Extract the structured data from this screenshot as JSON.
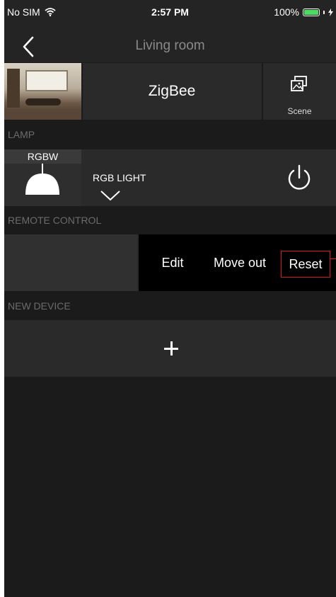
{
  "status_bar": {
    "carrier": "No SIM",
    "time": "2:57 PM",
    "battery": "100%",
    "wifi_icon": "wifi-icon",
    "battery_icon": "battery-icon",
    "charging_icon": "bolt-icon"
  },
  "nav": {
    "title": "Living room",
    "back_icon": "chevron-left-icon"
  },
  "room": {
    "protocol": "ZigBee",
    "scene_label": "Scene",
    "scene_icon": "scene-icon"
  },
  "sections": {
    "lamp": "LAMP",
    "remote_control": "REMOTE CONTROL",
    "new_device": "NEW DEVICE"
  },
  "lamp": {
    "type": "RGBW",
    "name": "RGB LIGHT",
    "icon": "lamp-icon",
    "power_icon": "power-icon",
    "expand_icon": "chevron-down-icon"
  },
  "remote_actions": {
    "edit": "Edit",
    "move_out": "Move out",
    "reset": "Reset"
  },
  "new_device": {
    "add_icon": "plus-icon"
  },
  "colors": {
    "background": "#1b1b1b",
    "row": "#2a2a2a",
    "highlight": "#e0141e"
  }
}
